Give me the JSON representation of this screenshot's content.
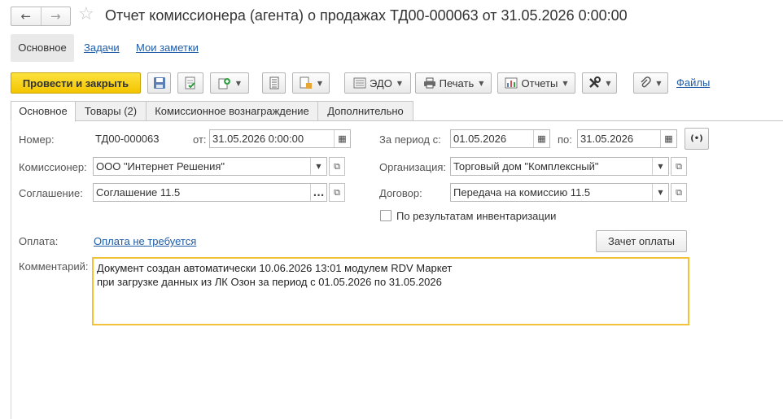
{
  "window": {
    "title": "Отчет комиссионера (агента) о продажах ТД00-000063 от 31.05.2026 0:00:00",
    "nav_back": "←",
    "nav_forward": "→",
    "favorite_icon": "☆"
  },
  "sections": {
    "main": "Основное",
    "tasks": "Задачи",
    "notes": "Мои заметки"
  },
  "toolbar": {
    "post_close": "Провести и закрыть",
    "edo": "ЭДО",
    "print": "Печать",
    "reports": "Отчеты",
    "files": "Файлы"
  },
  "tabs": [
    "Основное",
    "Товары (2)",
    "Комиссионное вознаграждение",
    "Дополнительно"
  ],
  "form": {
    "number_label": "Номер:",
    "number_value": "ТД00-000063",
    "date_label": "от:",
    "date_value": "31.05.2026  0:00:00",
    "period_from_label": "За период с:",
    "period_from_value": "01.05.2026",
    "period_to_label": "по:",
    "period_to_value": "31.05.2026",
    "commissioner_label": "Комиссионер:",
    "commissioner_value": "ООО \"Интернет Решения\"",
    "organization_label": "Организация:",
    "organization_value": "Торговый дом \"Комплексный\"",
    "agreement_label": "Соглашение:",
    "agreement_value": "Соглашение 11.5",
    "contract_label": "Договор:",
    "contract_value": "Передача на комиссию 11.5",
    "inventory_label": "По результатам инвентаризации",
    "inventory_checked": false,
    "payment_label": "Оплата:",
    "payment_value": "Оплата не требуется",
    "offset_button": "Зачет оплаты",
    "comment_label": "Комментарий:",
    "comment_value": "Документ создан автоматически 10.06.2026 13:01 модулем RDV Маркет\nпри загрузке данных из ЛК Озон за период с 01.05.2026 по 31.05.2026"
  },
  "colors": {
    "primary_button": "#f5c800",
    "link": "#1e5ca8",
    "comment_border": "#f2c23b"
  }
}
